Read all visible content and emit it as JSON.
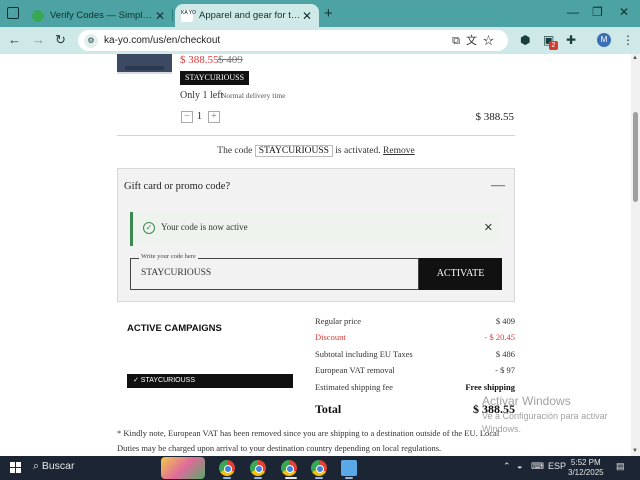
{
  "browser": {
    "tabs": [
      {
        "title": "Verify Codes — SimplyCodes",
        "active": false
      },
      {
        "title": "Apparel and gear for the curious",
        "active": true,
        "favicon_text": "KA YO"
      }
    ],
    "url": "ka-yo.com/us/en/checkout",
    "profile_initial": "M",
    "extension_badge": "2"
  },
  "product": {
    "sale_price": "$ 388.55",
    "original_price": "$ 409",
    "brand_tag": "STAYCURIOUSS",
    "stock_text": "Only 1 left",
    "delivery_text": "Normal delivery time",
    "quantity": "1",
    "line_total": "$ 388.55"
  },
  "code_status": {
    "prefix": "The code",
    "code": "STAYCURIOUSS",
    "suffix": "is activated.",
    "remove_label": "Remove"
  },
  "promo": {
    "title": "Gift card or promo code?",
    "collapse_symbol": "—",
    "alert_text": "Your code is now active",
    "field_legend": "Write your code here",
    "field_value": "STAYCURIOUSS",
    "button_label": "ACTIVATE"
  },
  "campaigns": {
    "title": "ACTIVE CAMPAIGNS",
    "items": [
      "✓ STAYCURIOUSS"
    ]
  },
  "summary": {
    "rows": [
      {
        "label": "Regular price",
        "value": "$ 409",
        "style": "normal"
      },
      {
        "label": "Discount",
        "value": "- $ 20.45",
        "style": "discount"
      },
      {
        "label": "Subtotal including EU Taxes",
        "value": "$ 486",
        "style": "normal"
      },
      {
        "label": "European VAT removal",
        "value": "- $ 97",
        "style": "normal"
      },
      {
        "label": "Estimated shipping fee",
        "value": "Free shipping",
        "style": "bold"
      }
    ],
    "total_label": "Total",
    "total_value": "$ 388.55"
  },
  "note": "* Kindly note, European VAT has been removed since you are shipping to a destination outside of the EU. Local Duties may be charged upon arrival to your destination country depending on local regulations.",
  "watermark": {
    "line1": "Activar Windows",
    "line2": "Ve a Configuración para activar Windows."
  },
  "taskbar": {
    "search_label": "Buscar",
    "language": "ESP",
    "time": "5:52 PM",
    "date": "3/12/2025"
  },
  "colors": {
    "tab_strip": "#4da3a3",
    "toolbar": "#cfe9e8",
    "sale_red": "#e03a3a",
    "alert_green": "#3a8a4f",
    "taskbar": "#1c2533"
  }
}
